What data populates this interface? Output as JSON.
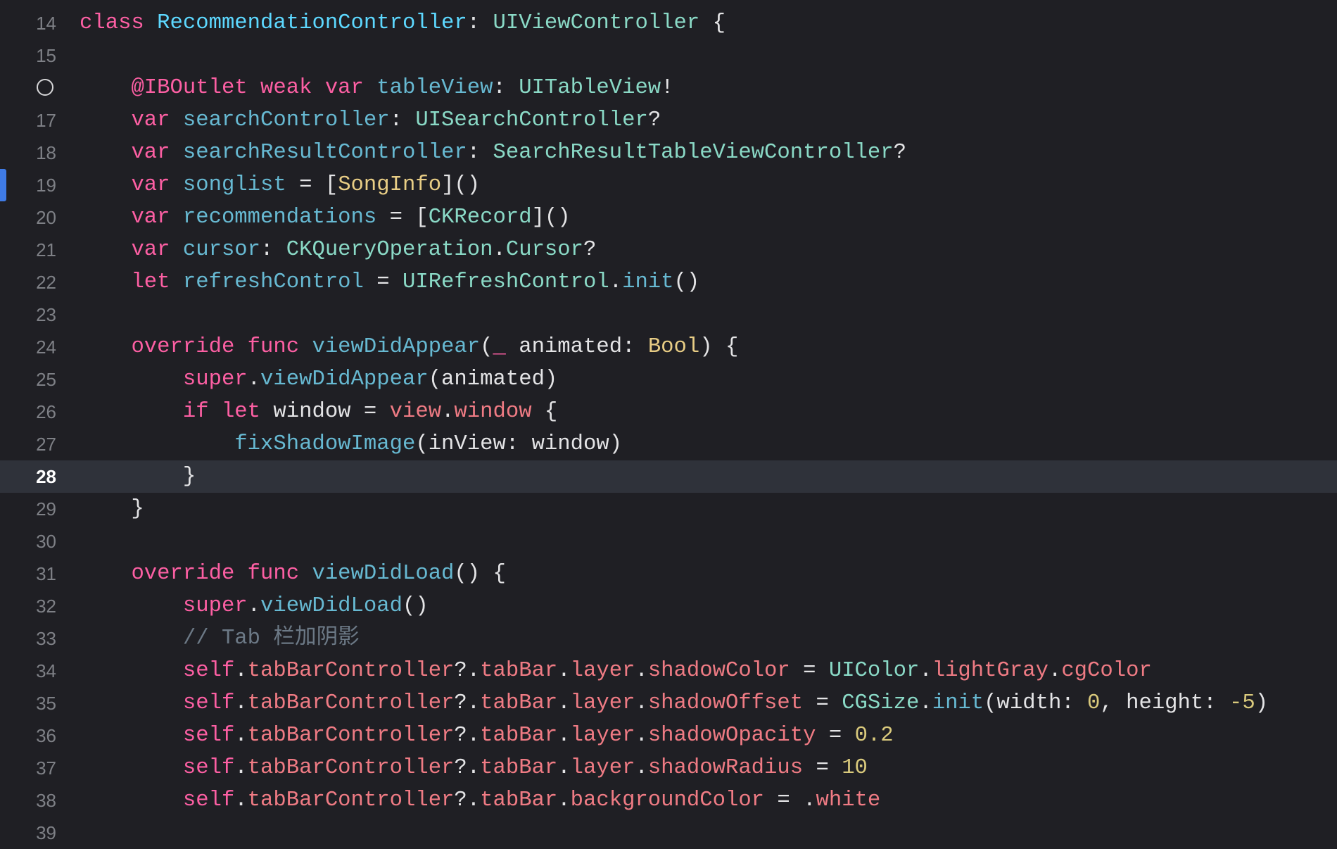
{
  "editor": {
    "current_line": 28,
    "changed_line": 19,
    "outlet_line": 16,
    "lines": [
      {
        "n": "14",
        "t": [
          [
            "kw",
            "class"
          ],
          [
            "pl",
            " "
          ],
          [
            "decl",
            "RecommendationController"
          ],
          [
            "pl",
            ": "
          ],
          [
            "type",
            "UIViewController"
          ],
          [
            "pl",
            " {"
          ]
        ]
      },
      {
        "n": "15",
        "t": []
      },
      {
        "n": "",
        "t": [
          [
            "pl",
            "    "
          ],
          [
            "kw",
            "@IBOutlet"
          ],
          [
            "pl",
            " "
          ],
          [
            "kw",
            "weak"
          ],
          [
            "pl",
            " "
          ],
          [
            "kw",
            "var"
          ],
          [
            "pl",
            " "
          ],
          [
            "name",
            "tableView"
          ],
          [
            "pl",
            ": "
          ],
          [
            "type",
            "UITableView"
          ],
          [
            "pl",
            "!"
          ]
        ]
      },
      {
        "n": "17",
        "t": [
          [
            "pl",
            "    "
          ],
          [
            "kw",
            "var"
          ],
          [
            "pl",
            " "
          ],
          [
            "name",
            "searchController"
          ],
          [
            "pl",
            ": "
          ],
          [
            "type",
            "UISearchController"
          ],
          [
            "pl",
            "?"
          ]
        ]
      },
      {
        "n": "18",
        "t": [
          [
            "pl",
            "    "
          ],
          [
            "kw",
            "var"
          ],
          [
            "pl",
            " "
          ],
          [
            "name",
            "searchResultController"
          ],
          [
            "pl",
            ": "
          ],
          [
            "type",
            "SearchResultTableViewController"
          ],
          [
            "pl",
            "?"
          ]
        ]
      },
      {
        "n": "19",
        "t": [
          [
            "pl",
            "    "
          ],
          [
            "kw",
            "var"
          ],
          [
            "pl",
            " "
          ],
          [
            "name",
            "songlist"
          ],
          [
            "pl",
            " = ["
          ],
          [
            "ptype",
            "SongInfo"
          ],
          [
            "pl",
            "]()"
          ]
        ]
      },
      {
        "n": "20",
        "t": [
          [
            "pl",
            "    "
          ],
          [
            "kw",
            "var"
          ],
          [
            "pl",
            " "
          ],
          [
            "name",
            "recommendations"
          ],
          [
            "pl",
            " = ["
          ],
          [
            "type",
            "CKRecord"
          ],
          [
            "pl",
            "]()"
          ]
        ]
      },
      {
        "n": "21",
        "t": [
          [
            "pl",
            "    "
          ],
          [
            "kw",
            "var"
          ],
          [
            "pl",
            " "
          ],
          [
            "name",
            "cursor"
          ],
          [
            "pl",
            ": "
          ],
          [
            "type",
            "CKQueryOperation"
          ],
          [
            "pl",
            "."
          ],
          [
            "type",
            "Cursor"
          ],
          [
            "pl",
            "?"
          ]
        ]
      },
      {
        "n": "22",
        "t": [
          [
            "pl",
            "    "
          ],
          [
            "kw",
            "let"
          ],
          [
            "pl",
            " "
          ],
          [
            "name",
            "refreshControl"
          ],
          [
            "pl",
            " = "
          ],
          [
            "type",
            "UIRefreshControl"
          ],
          [
            "pl",
            "."
          ],
          [
            "fn",
            "init"
          ],
          [
            "pl",
            "()"
          ]
        ]
      },
      {
        "n": "23",
        "t": []
      },
      {
        "n": "24",
        "t": [
          [
            "pl",
            "    "
          ],
          [
            "kw",
            "override"
          ],
          [
            "pl",
            " "
          ],
          [
            "kw",
            "func"
          ],
          [
            "pl",
            " "
          ],
          [
            "name",
            "viewDidAppear"
          ],
          [
            "pl",
            "("
          ],
          [
            "kw",
            "_"
          ],
          [
            "pl",
            " animated: "
          ],
          [
            "ptype",
            "Bool"
          ],
          [
            "pl",
            ") {"
          ]
        ]
      },
      {
        "n": "25",
        "t": [
          [
            "pl",
            "        "
          ],
          [
            "kw",
            "super"
          ],
          [
            "pl",
            "."
          ],
          [
            "fn",
            "viewDidAppear"
          ],
          [
            "pl",
            "(animated)"
          ]
        ]
      },
      {
        "n": "26",
        "t": [
          [
            "pl",
            "        "
          ],
          [
            "kw",
            "if"
          ],
          [
            "pl",
            " "
          ],
          [
            "kw",
            "let"
          ],
          [
            "pl",
            " window = "
          ],
          [
            "prop",
            "view"
          ],
          [
            "pl",
            "."
          ],
          [
            "prop",
            "window"
          ],
          [
            "pl",
            " {"
          ]
        ]
      },
      {
        "n": "27",
        "t": [
          [
            "pl",
            "            "
          ],
          [
            "fn",
            "fixShadowImage"
          ],
          [
            "pl",
            "(inView: window)"
          ]
        ]
      },
      {
        "n": "28",
        "t": [
          [
            "pl",
            "        }"
          ]
        ]
      },
      {
        "n": "29",
        "t": [
          [
            "pl",
            "    }"
          ]
        ]
      },
      {
        "n": "30",
        "t": []
      },
      {
        "n": "31",
        "t": [
          [
            "pl",
            "    "
          ],
          [
            "kw",
            "override"
          ],
          [
            "pl",
            " "
          ],
          [
            "kw",
            "func"
          ],
          [
            "pl",
            " "
          ],
          [
            "name",
            "viewDidLoad"
          ],
          [
            "pl",
            "() {"
          ]
        ]
      },
      {
        "n": "32",
        "t": [
          [
            "pl",
            "        "
          ],
          [
            "kw",
            "super"
          ],
          [
            "pl",
            "."
          ],
          [
            "fn",
            "viewDidLoad"
          ],
          [
            "pl",
            "()"
          ]
        ]
      },
      {
        "n": "33",
        "t": [
          [
            "pl",
            "        "
          ],
          [
            "cmt",
            "// Tab 栏加阴影"
          ]
        ]
      },
      {
        "n": "34",
        "t": [
          [
            "pl",
            "        "
          ],
          [
            "kw",
            "self"
          ],
          [
            "pl",
            "."
          ],
          [
            "prop",
            "tabBarController"
          ],
          [
            "pl",
            "?."
          ],
          [
            "prop",
            "tabBar"
          ],
          [
            "pl",
            "."
          ],
          [
            "prop",
            "layer"
          ],
          [
            "pl",
            "."
          ],
          [
            "prop",
            "shadowColor"
          ],
          [
            "pl",
            " = "
          ],
          [
            "type",
            "UIColor"
          ],
          [
            "pl",
            "."
          ],
          [
            "prop",
            "lightGray"
          ],
          [
            "pl",
            "."
          ],
          [
            "prop",
            "cgColor"
          ]
        ]
      },
      {
        "n": "35",
        "t": [
          [
            "pl",
            "        "
          ],
          [
            "kw",
            "self"
          ],
          [
            "pl",
            "."
          ],
          [
            "prop",
            "tabBarController"
          ],
          [
            "pl",
            "?."
          ],
          [
            "prop",
            "tabBar"
          ],
          [
            "pl",
            "."
          ],
          [
            "prop",
            "layer"
          ],
          [
            "pl",
            "."
          ],
          [
            "prop",
            "shadowOffset"
          ],
          [
            "pl",
            " = "
          ],
          [
            "type",
            "CGSize"
          ],
          [
            "pl",
            "."
          ],
          [
            "fn",
            "init"
          ],
          [
            "pl",
            "(width: "
          ],
          [
            "num",
            "0"
          ],
          [
            "pl",
            ", height: "
          ],
          [
            "num",
            "-5"
          ],
          [
            "pl",
            ")"
          ]
        ]
      },
      {
        "n": "36",
        "t": [
          [
            "pl",
            "        "
          ],
          [
            "kw",
            "self"
          ],
          [
            "pl",
            "."
          ],
          [
            "prop",
            "tabBarController"
          ],
          [
            "pl",
            "?."
          ],
          [
            "prop",
            "tabBar"
          ],
          [
            "pl",
            "."
          ],
          [
            "prop",
            "layer"
          ],
          [
            "pl",
            "."
          ],
          [
            "prop",
            "shadowOpacity"
          ],
          [
            "pl",
            " = "
          ],
          [
            "num",
            "0.2"
          ]
        ]
      },
      {
        "n": "37",
        "t": [
          [
            "pl",
            "        "
          ],
          [
            "kw",
            "self"
          ],
          [
            "pl",
            "."
          ],
          [
            "prop",
            "tabBarController"
          ],
          [
            "pl",
            "?."
          ],
          [
            "prop",
            "tabBar"
          ],
          [
            "pl",
            "."
          ],
          [
            "prop",
            "layer"
          ],
          [
            "pl",
            "."
          ],
          [
            "prop",
            "shadowRadius"
          ],
          [
            "pl",
            " = "
          ],
          [
            "num",
            "10"
          ]
        ]
      },
      {
        "n": "38",
        "t": [
          [
            "pl",
            "        "
          ],
          [
            "kw",
            "self"
          ],
          [
            "pl",
            "."
          ],
          [
            "prop",
            "tabBarController"
          ],
          [
            "pl",
            "?."
          ],
          [
            "prop",
            "tabBar"
          ],
          [
            "pl",
            "."
          ],
          [
            "prop",
            "backgroundColor"
          ],
          [
            "pl",
            " = ."
          ],
          [
            "prop",
            "white"
          ]
        ]
      },
      {
        "n": "39",
        "t": []
      }
    ]
  }
}
